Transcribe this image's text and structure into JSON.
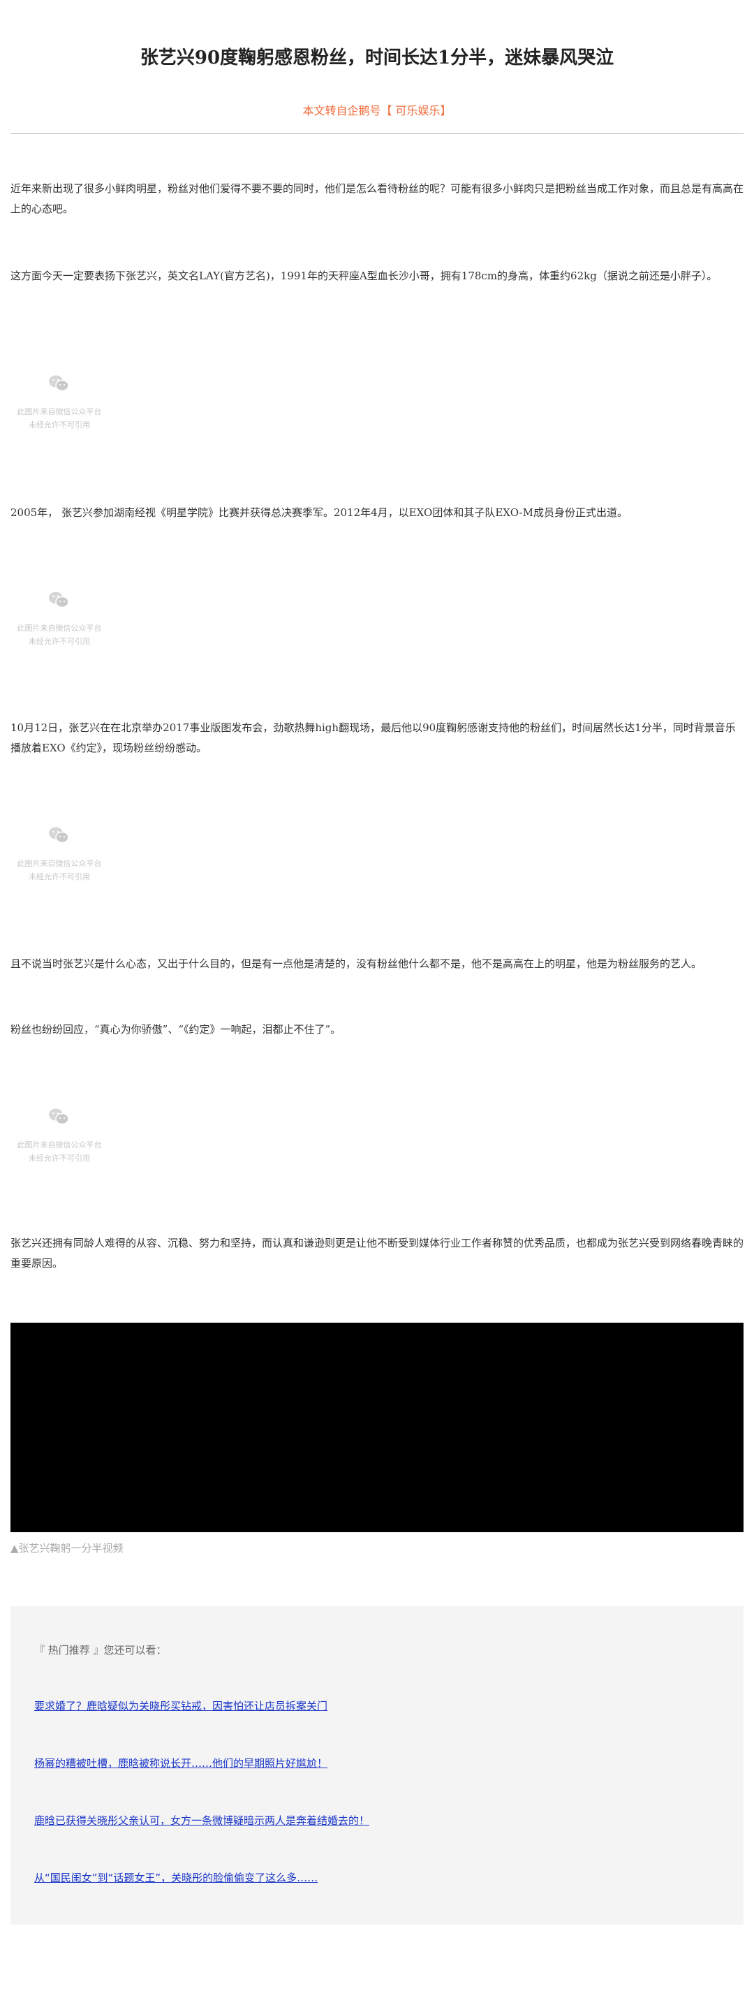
{
  "article": {
    "title": "张艺兴90度鞠躬感恩粉丝，时间长达1分半，迷妹暴风哭泣",
    "source": "本文转自企鹅号【 可乐娱乐】"
  },
  "paragraphs": [
    "近年来新出现了很多小鲜肉明星，粉丝对他们爱得不要不要的同时，他们是怎么看待粉丝的呢？可能有很多小鲜肉只是把粉丝当成工作对象，而且总是有高高在上的心态吧。",
    "这方面今天一定要表扬下张艺兴，英文名LAY(官方艺名)，1991年的天秤座A型血长沙小哥，拥有178cm的身高，体重约62kg（据说之前还是小胖子）。",
    "2005年， 张艺兴参加湖南经视《明星学院》比赛并获得总决赛季军。2012年4月，以EXO团体和其子队EXO-M成员身份正式出道。",
    "10月12日，张艺兴在在北京举办2017事业版图发布会，劲歌热舞high翻现场，最后他以90度鞠躬感谢支持他的粉丝们，时间居然长达1分半，同时背景音乐播放着EXO《约定》，现场粉丝纷纷感动。",
    "且不说当时张艺兴是什么心态，又出于什么目的，但是有一点他是清楚的，没有粉丝他什么都不是，他不是高高在上的明星，他是为粉丝服务的艺人。",
    "粉丝也纷纷回应，“真心为你骄傲”、“《约定》一响起，泪都止不住了”。",
    "张艺兴还拥有同龄人难得的从容、沉稳、努力和坚持，而认真和谦逊则更是让他不断受到媒体行业工作者称赞的优秀品质，也都成为张艺兴受到网络春晚青睐的重要原因。"
  ],
  "image_placeholder": {
    "line1": "此图片来自微信公众平台",
    "line2": "未经允许不可引用"
  },
  "video": {
    "caption": "▲张艺兴鞠躬一分半视频"
  },
  "recommend": {
    "heading": "『 热门推荐 』您还可以看：",
    "links": [
      "要求婚了？鹿晗疑似为关晓彤买钻戒，因害怕还让店员拆案关门",
      "杨幂的糟被吐槽，鹿晗被称说长开……他们的早期照片好尴尬！",
      "鹿晗已获得关晓彤父亲认可，女方一条微博疑暗示两人是奔着结婚去的！",
      "从“国民闺女”到“话题女王”，关晓彤的脸偷偷变了这么多……"
    ]
  },
  "colors": {
    "source_accent": "#f26b3a",
    "link": "#1a35c8",
    "panel_bg": "#f4f4f4"
  }
}
